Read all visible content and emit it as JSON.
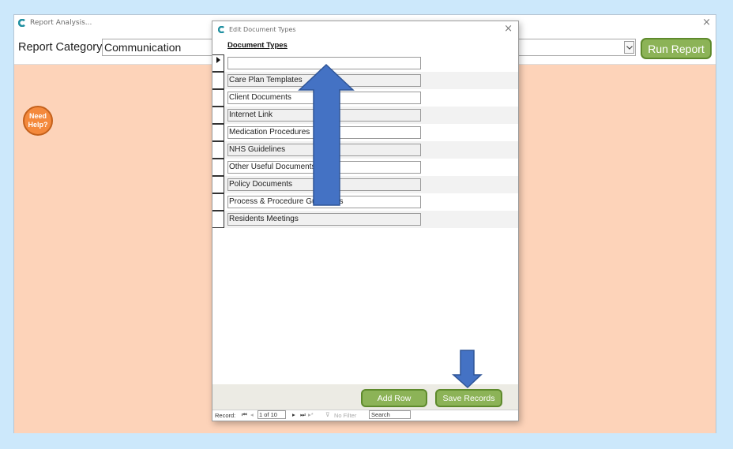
{
  "main_window": {
    "title": "Report Analysis...",
    "close_glyph": "×"
  },
  "toolbar": {
    "category_label": "Report Category:",
    "category_value": "Communication",
    "run_button": "Run Report"
  },
  "help_button": "Need\nHelp?",
  "dialog": {
    "title": "Edit Document Types",
    "close_glyph": "×",
    "header": "Document Types",
    "rows": [
      "",
      "Care Plan Templates",
      "Client Documents",
      "Internet Link",
      "Medication Procedures",
      "NHS Guidelines",
      "Other Useful Documents",
      "Policy Documents",
      "Process & Procedure Guidelines",
      "Residents Meetings"
    ],
    "add_row_button": "Add Row",
    "save_records_button": "Save Records"
  },
  "record_nav": {
    "label": "Record:",
    "first_glyph": "⏮",
    "prev_glyph": "◂",
    "position": "1 of 10",
    "next_glyph": "▸",
    "last_glyph": "⏭",
    "new_glyph": "▸*",
    "filter_icon_glyph": "⊽",
    "filter_text": "No Filter",
    "search_text": "Search"
  },
  "colors": {
    "page_background": "#cce8fb",
    "content_background": "#fdd3b9",
    "button_green": "#8cb357",
    "help_orange": "#f4893c",
    "annotation_arrow_blue": "#4472c4",
    "app_icon_teal": "#1f8fa0"
  },
  "icons": {
    "app": "c-logo-icon",
    "close": "close-icon",
    "dropdown": "chevron-down-icon",
    "record_selector": "current-record-triangle-icon",
    "annotation_arrows": [
      "arrow-up-icon",
      "arrow-down-icon"
    ]
  }
}
